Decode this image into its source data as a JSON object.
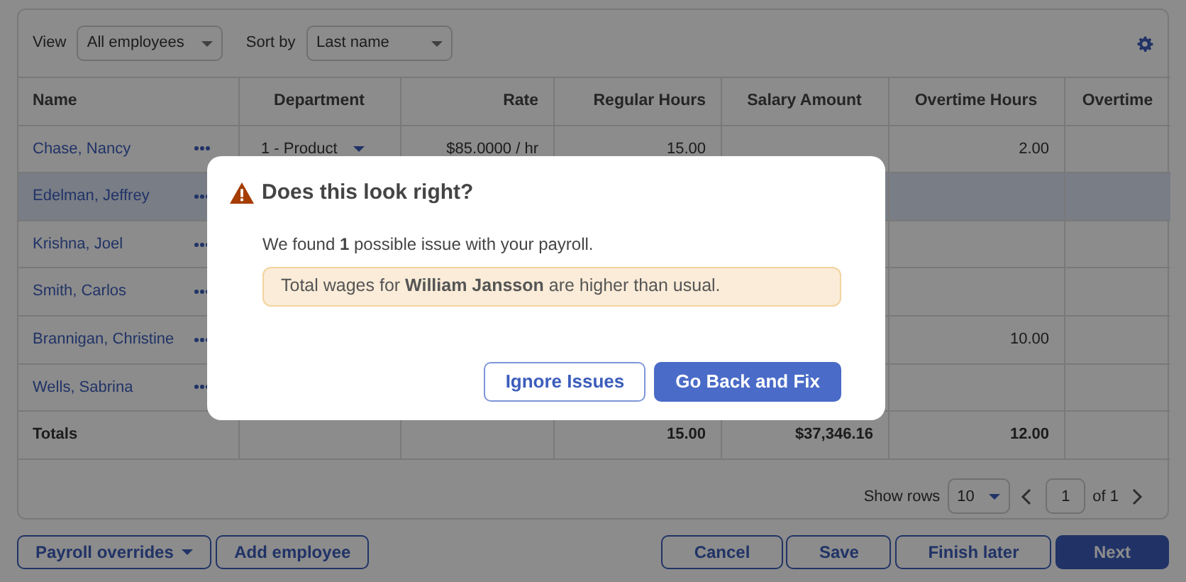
{
  "toolbar": {
    "view_label": "View",
    "view_value": "All employees",
    "sort_label": "Sort by",
    "sort_value": "Last name"
  },
  "table": {
    "columns": [
      "Name",
      "Department",
      "Rate",
      "Regular Hours",
      "Salary Amount",
      "Overtime Hours",
      "Overtime"
    ],
    "rows": [
      {
        "name": "Chase, Nancy",
        "selected": false,
        "department": "1 - Product",
        "rate": "$85.0000 / hr",
        "regular_hours": "15.00",
        "overtime_hours": "2.00"
      },
      {
        "name": "Edelman, Jeffrey",
        "selected": true
      },
      {
        "name": "Krishna, Joel",
        "selected": false
      },
      {
        "name": "Smith, Carlos",
        "selected": false
      },
      {
        "name": "Brannigan, Christine",
        "selected": false,
        "overtime_hours": "10.00"
      },
      {
        "name": "Wells, Sabrina",
        "selected": false
      }
    ],
    "totals": {
      "label": "Totals",
      "regular_hours": "15.00",
      "salary_amount": "$37,346.16",
      "overtime_hours": "12.00"
    }
  },
  "pagination": {
    "label": "Show rows",
    "rows_value": "10",
    "page": "1",
    "of": "of 1"
  },
  "footer": {
    "left": [
      {
        "label": "Payroll overrides",
        "kind": "dropdown"
      },
      {
        "label": "Add employee",
        "kind": "plain"
      }
    ],
    "right": [
      {
        "label": "Cancel",
        "kind": "plain"
      },
      {
        "label": "Save",
        "kind": "plain"
      },
      {
        "label": "Finish later",
        "kind": "plain"
      },
      {
        "label": "Next",
        "kind": "primary"
      }
    ]
  },
  "dialog": {
    "title": "Does this look right?",
    "message": "We found **1** possible issue with your payroll.",
    "issue": "Total wages for **William Jansson** are higher than usual.",
    "buttons": [
      {
        "label": "Ignore Issues",
        "kind": "outline"
      },
      {
        "label": "Go Back and Fix",
        "kind": "primary"
      }
    ]
  }
}
